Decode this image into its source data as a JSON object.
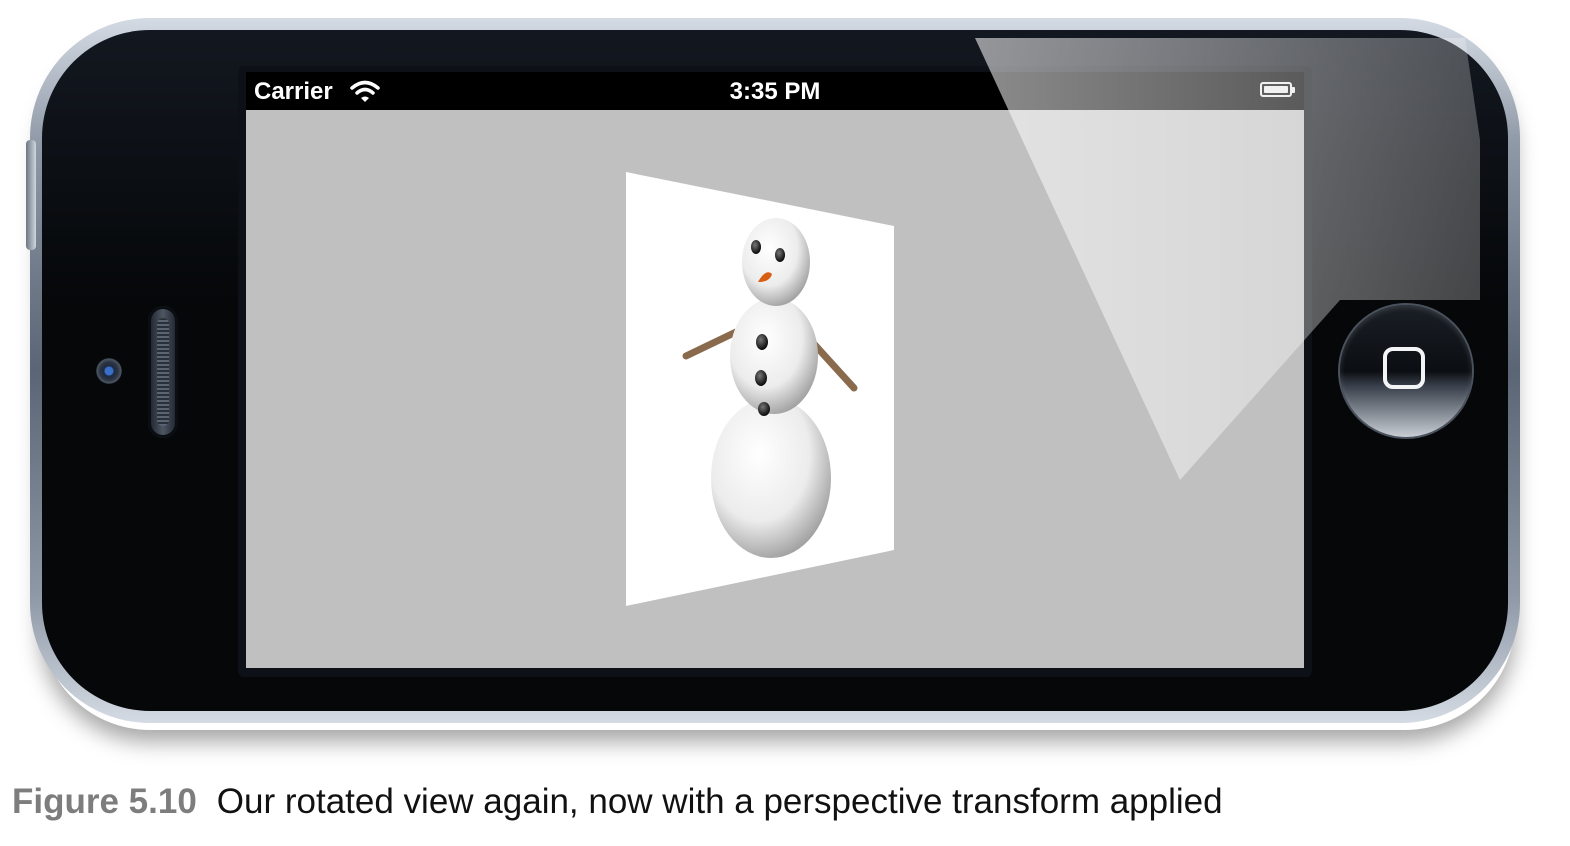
{
  "status_bar": {
    "carrier": "Carrier",
    "time": "3:35 PM",
    "wifi_icon": "wifi-icon",
    "battery_icon": "battery-icon"
  },
  "app": {
    "background_color": "#c0c0c0",
    "layer_color": "#ffffff",
    "image_subject": "snowman"
  },
  "device": {
    "home_button_icon": "home-square-icon",
    "camera_icon": "camera-icon"
  },
  "caption": {
    "figure_label": "Figure 5.10",
    "text": "Our rotated view again, now with a perspective transform applied"
  }
}
